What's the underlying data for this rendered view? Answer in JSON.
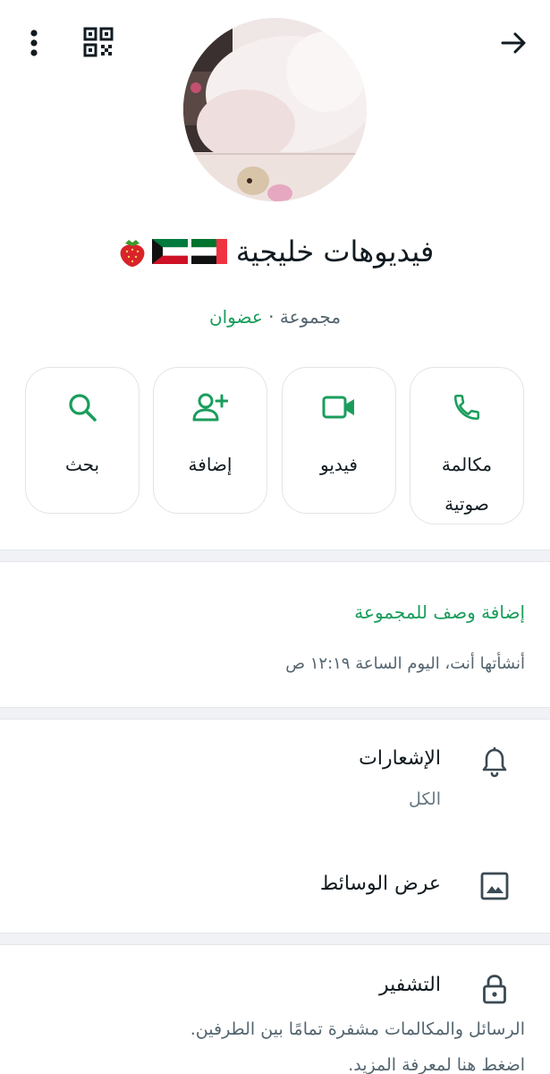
{
  "header": {
    "menu_icon": "more-vert-icon",
    "qr_icon": "qr-code-icon",
    "back_icon": "arrow-forward-icon"
  },
  "group": {
    "name": "فيديوهات خليجية",
    "emoji": [
      "uae-flag",
      "kuwait-flag",
      "strawberry"
    ],
    "type_label": "مجموعة",
    "separator": "·",
    "members_label": "عضوان"
  },
  "actions": [
    {
      "label": "مكالمة صوتية",
      "icon": "phone-icon"
    },
    {
      "label": "فيديو",
      "icon": "video-camera-icon"
    },
    {
      "label": "إضافة",
      "icon": "add-person-icon"
    },
    {
      "label": "بحث",
      "icon": "search-icon"
    }
  ],
  "description": {
    "add_label": "إضافة وصف للمجموعة",
    "created_text": "أنشأتها أنت، اليوم الساعة ١٢:١٩ ص"
  },
  "notifications": {
    "title": "الإشعارات",
    "value": "الكل",
    "icon": "bell-icon"
  },
  "media": {
    "title": "عرض الوسائط",
    "icon": "image-icon"
  },
  "encryption": {
    "title": "التشفير",
    "line1": "الرسائل والمكالمات مشفرة تمامًا بين الطرفين.",
    "line2": "اضغط هنا لمعرفة المزيد.",
    "icon": "lock-icon"
  },
  "colors": {
    "accent": "#1a9d5c",
    "text_primary": "#111b21",
    "text_secondary": "#667781",
    "divider": "#f0f2f5"
  }
}
